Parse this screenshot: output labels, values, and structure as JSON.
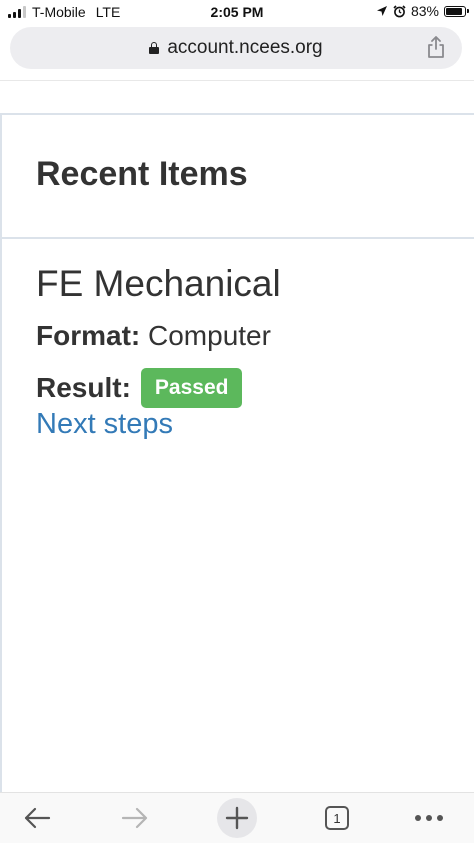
{
  "status_bar": {
    "carrier": "T-Mobile",
    "network": "LTE",
    "time": "2:05 PM",
    "battery": "83%"
  },
  "url_bar": {
    "url": "account.ncees.org"
  },
  "card": {
    "title": "Recent Items",
    "exam_name": "FE Mechanical",
    "format_label": "Format:",
    "format_value": "Computer",
    "result_label": "Result:",
    "result_value": "Passed",
    "next_steps": "Next steps"
  },
  "toolbar": {
    "tab_count": "1"
  },
  "colors": {
    "badge_success": "#5cb85c",
    "link": "#337ab7"
  },
  "icons": [
    "signal-icon",
    "location-icon",
    "alarm-icon",
    "battery-icon",
    "lock-icon",
    "share-icon",
    "back-arrow-icon",
    "forward-arrow-icon",
    "new-tab-plus-icon",
    "tabs-icon",
    "more-icon"
  ]
}
